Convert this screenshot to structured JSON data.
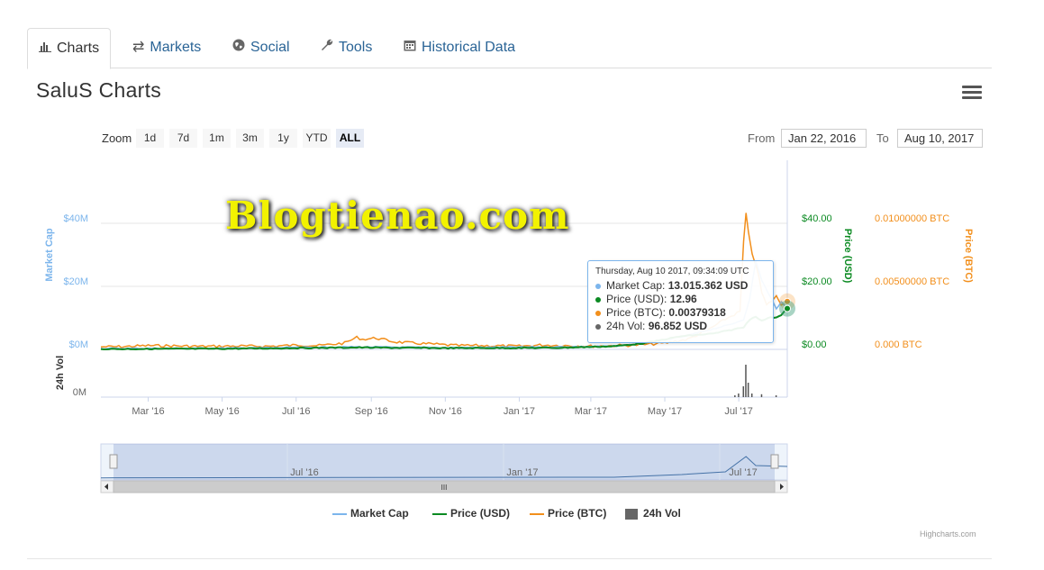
{
  "tabs": [
    {
      "label": "Charts",
      "icon": "bar-chart-icon",
      "active": true
    },
    {
      "label": "Markets",
      "icon": "exchange-icon"
    },
    {
      "label": "Social",
      "icon": "globe-icon"
    },
    {
      "label": "Tools",
      "icon": "wrench-icon"
    },
    {
      "label": "Historical Data",
      "icon": "calendar-icon"
    }
  ],
  "page_title": "SaluS Charts",
  "zoom": {
    "label": "Zoom",
    "buttons": [
      "1d",
      "7d",
      "1m",
      "3m",
      "1y",
      "YTD",
      "ALL"
    ],
    "active": "ALL"
  },
  "range": {
    "from_label": "From",
    "from_value": "Jan 22, 2016",
    "to_label": "To",
    "to_value": "Aug 10, 2017"
  },
  "watermark": "Blogtienao.com",
  "tooltip": {
    "header": "Thursday, Aug 10 2017, 09:34:09 UTC",
    "rows": [
      {
        "label": "Market Cap:",
        "value": "13.015.362 USD",
        "color": "#7cb5ec"
      },
      {
        "label": "Price (USD):",
        "value": "12.96",
        "color": "#0b8a22"
      },
      {
        "label": "Price (BTC):",
        "value": "0.00379318",
        "color": "#f28f1c"
      },
      {
        "label": "24h Vol:",
        "value": "96.852 USD",
        "color": "#666666"
      }
    ]
  },
  "credit": "Highcharts.com",
  "navigator": {
    "labels": [
      "Jul '16",
      "Jan '17",
      "Jul '17"
    ],
    "scroll_grip": "III"
  },
  "chart_data": {
    "type": "line",
    "colors": {
      "market_cap": "#7cb5ec",
      "price_usd": "#0b8a22",
      "price_btc": "#f28f1c",
      "volume": "#555555"
    },
    "x_ticks": [
      "Mar '16",
      "May '16",
      "Jul '16",
      "Sep '16",
      "Nov '16",
      "Jan '17",
      "Mar '17",
      "May '17",
      "Jul '17"
    ],
    "axes": {
      "market_cap": {
        "label": "Market Cap",
        "ticks": [
          "$0M",
          "$20M",
          "$40M"
        ],
        "range": [
          0,
          40
        ]
      },
      "price_usd": {
        "label": "Price (USD)",
        "ticks": [
          "$0.00",
          "$20.00",
          "$40.00"
        ],
        "range": [
          0,
          40
        ]
      },
      "price_btc": {
        "label": "Price (BTC)",
        "ticks": [
          "0.000 BTC",
          "0.00500000 BTC",
          "0.01000000 BTC"
        ],
        "range": [
          0,
          0.01
        ]
      },
      "volume": {
        "label": "24h Vol",
        "ticks": [
          "0M"
        ]
      }
    },
    "x_range": [
      "2016-01-22",
      "2017-08-10"
    ],
    "series": [
      {
        "name": "Price (BTC)",
        "key": "price_btc",
        "axis": "price_btc",
        "points": [
          [
            "2016-01-22",
            0.0002
          ],
          [
            "2016-02-10",
            0.00022
          ],
          [
            "2016-03-01",
            0.0003
          ],
          [
            "2016-03-20",
            0.00028
          ],
          [
            "2016-04-15",
            0.00024
          ],
          [
            "2016-05-10",
            0.00026
          ],
          [
            "2016-06-10",
            0.00025
          ],
          [
            "2016-07-05",
            0.00035
          ],
          [
            "2016-07-20",
            0.0003
          ],
          [
            "2016-08-10",
            0.0005
          ],
          [
            "2016-08-20",
            0.00095
          ],
          [
            "2016-08-25",
            0.0008
          ],
          [
            "2016-09-05",
            0.0009
          ],
          [
            "2016-09-20",
            0.0006
          ],
          [
            "2016-10-05",
            0.0005
          ],
          [
            "2016-10-25",
            0.0004
          ],
          [
            "2016-11-10",
            0.0003
          ],
          [
            "2016-12-01",
            0.0003
          ],
          [
            "2017-01-01",
            0.00025
          ],
          [
            "2017-01-20",
            0.00035
          ],
          [
            "2017-02-10",
            0.0003
          ],
          [
            "2017-03-01",
            0.00025
          ],
          [
            "2017-03-20",
            0.0003
          ],
          [
            "2017-04-10",
            0.00035
          ],
          [
            "2017-05-01",
            0.0005
          ],
          [
            "2017-05-20",
            0.0008
          ],
          [
            "2017-06-05",
            0.0015
          ],
          [
            "2017-06-20",
            0.0024
          ],
          [
            "2017-07-02",
            0.003
          ],
          [
            "2017-07-05",
            0.0085
          ],
          [
            "2017-07-07",
            0.0108
          ],
          [
            "2017-07-09",
            0.0092
          ],
          [
            "2017-07-12",
            0.0075
          ],
          [
            "2017-07-16",
            0.0065
          ],
          [
            "2017-07-20",
            0.0045
          ],
          [
            "2017-07-24",
            0.0035
          ],
          [
            "2017-08-01",
            0.0042
          ],
          [
            "2017-08-05",
            0.0036
          ],
          [
            "2017-08-10",
            0.0038
          ]
        ]
      },
      {
        "name": "Market Cap",
        "key": "market_cap",
        "axis": "market_cap",
        "points": [
          [
            "2016-01-22",
            0.3
          ],
          [
            "2016-05-01",
            0.4
          ],
          [
            "2016-08-20",
            0.8
          ],
          [
            "2016-11-01",
            0.6
          ],
          [
            "2017-02-01",
            0.8
          ],
          [
            "2017-03-20",
            1.0
          ],
          [
            "2017-04-15",
            2.0
          ],
          [
            "2017-05-15",
            4.0
          ],
          [
            "2017-06-10",
            6.5
          ],
          [
            "2017-06-25",
            8.0
          ],
          [
            "2017-07-05",
            9.5
          ],
          [
            "2017-07-10",
            16
          ],
          [
            "2017-07-15",
            28
          ],
          [
            "2017-07-20",
            22
          ],
          [
            "2017-07-25",
            18
          ],
          [
            "2017-08-01",
            13
          ],
          [
            "2017-08-05",
            15
          ],
          [
            "2017-08-10",
            13.0
          ]
        ]
      },
      {
        "name": "Price (USD)",
        "key": "price_usd",
        "axis": "price_usd",
        "points": [
          [
            "2016-01-22",
            0.1
          ],
          [
            "2016-05-01",
            0.2
          ],
          [
            "2016-08-20",
            0.6
          ],
          [
            "2016-11-01",
            0.4
          ],
          [
            "2017-02-01",
            0.5
          ],
          [
            "2017-03-20",
            1.0
          ],
          [
            "2017-04-15",
            2.0
          ],
          [
            "2017-05-15",
            4.2
          ],
          [
            "2017-06-10",
            5.0
          ],
          [
            "2017-06-25",
            6.2
          ],
          [
            "2017-07-05",
            7.0
          ],
          [
            "2017-07-10",
            9.5
          ],
          [
            "2017-07-15",
            10.5
          ],
          [
            "2017-07-20",
            9.0
          ],
          [
            "2017-07-25",
            10.0
          ],
          [
            "2017-08-01",
            10.2
          ],
          [
            "2017-08-05",
            11.0
          ],
          [
            "2017-08-10",
            12.96
          ]
        ]
      }
    ],
    "volume": [
      [
        "2017-06-28",
        0.05
      ],
      [
        "2017-07-01",
        0.1
      ],
      [
        "2017-07-05",
        0.3
      ],
      [
        "2017-07-07",
        0.9
      ],
      [
        "2017-07-09",
        0.4
      ],
      [
        "2017-07-12",
        0.1
      ],
      [
        "2017-07-20",
        0.08
      ],
      [
        "2017-08-01",
        0.05
      ]
    ],
    "navigator_series": [
      [
        "2016-01-22",
        0.3
      ],
      [
        "2016-08-20",
        0.8
      ],
      [
        "2017-03-20",
        1.0
      ],
      [
        "2017-05-15",
        4.0
      ],
      [
        "2017-06-20",
        7.0
      ],
      [
        "2017-07-07",
        24
      ],
      [
        "2017-07-15",
        14
      ],
      [
        "2017-08-10",
        13
      ]
    ],
    "legend": [
      "Market Cap",
      "Price (USD)",
      "Price (BTC)",
      "24h Vol"
    ]
  }
}
